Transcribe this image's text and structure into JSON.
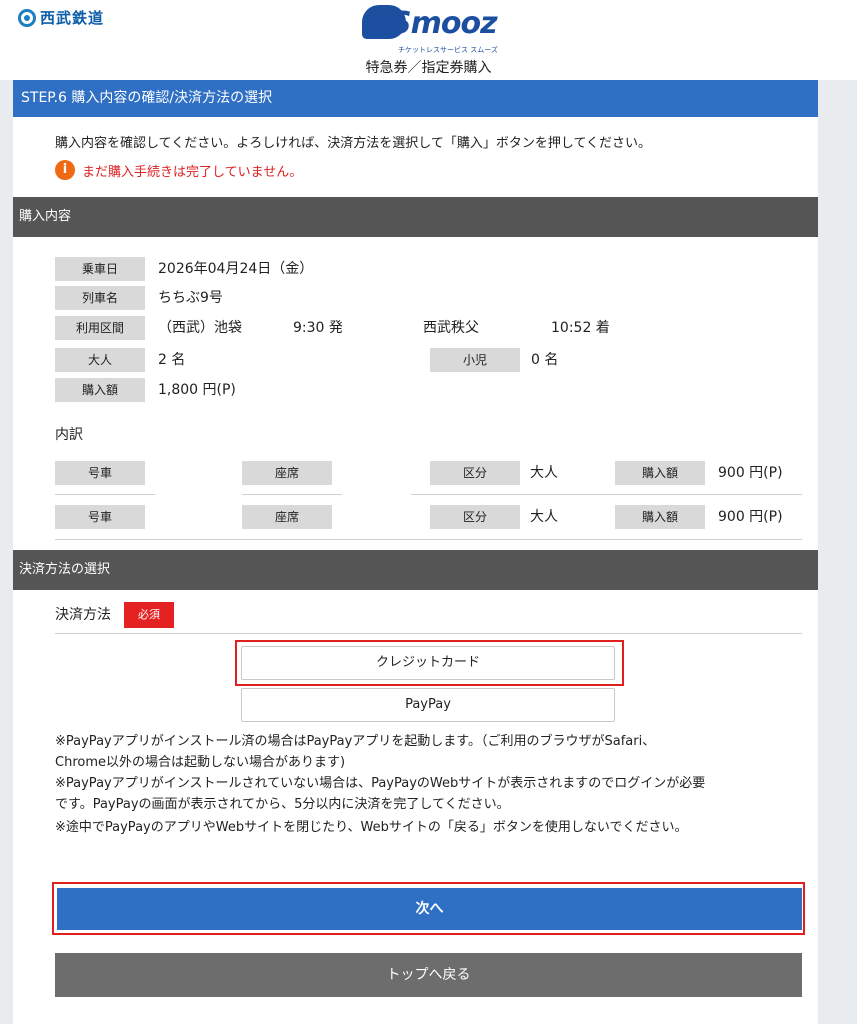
{
  "header": {
    "company_name": "西武鉄道",
    "service_logo": "Smooz",
    "service_tagline": "チケットレスサービス スムーズ",
    "page_subtitle": "特急券／指定券購入"
  },
  "step": {
    "title": "STEP.6 購入内容の確認/決済方法の選択",
    "instruction": "購入内容を確認してください。よろしければ、決済方法を選択して「購入」ボタンを押してください。",
    "warning_icon": "i",
    "warning": "まだ購入手続きは完了していません。"
  },
  "purchase": {
    "section_title": "購入内容",
    "date_label": "乗車日",
    "date_value": "2026年04月24日（金）",
    "train_label": "列車名",
    "train_value": "ちちぶ9号",
    "route_label": "利用区間",
    "route_from": "（西武）池袋",
    "depart_time": "9:30 発",
    "route_to": "西武秩父",
    "arrive_time": "10:52 着",
    "adult_label": "大人",
    "adult_value": "2 名",
    "child_label": "小児",
    "child_value": "0 名",
    "amount_label": "購入額",
    "amount_value": "1,800 円(P)",
    "breakdown_label": "内訳",
    "breakdown": [
      {
        "car_label": "号車",
        "seat_label": "座席",
        "type_label": "区分",
        "type_value": "大人",
        "price_label": "購入額",
        "price_value": "900 円(P)"
      },
      {
        "car_label": "号車",
        "seat_label": "座席",
        "type_label": "区分",
        "type_value": "大人",
        "price_label": "購入額",
        "price_value": "900 円(P)"
      }
    ]
  },
  "payment": {
    "section_title": "決済方法の選択",
    "method_label": "決済方法",
    "required_badge": "必須",
    "option_credit": "クレジットカード",
    "option_paypay": "PayPay",
    "notes": [
      "※PayPayアプリがインストール済の場合はPayPayアプリを起動します。（ご利用のブラウザがSafari、",
      "Chrome以外の場合は起動しない場合があります)",
      "※PayPayアプリがインストールされていない場合は、PayPayのWebサイトが表示されますのでログインが必要",
      "です。PayPayの画面が表示されてから、5分以内に決済を完了してください。",
      "※途中でPayPayのアプリやWebサイトを閉じたり、Webサイトの「戻る」ボタンを使用しないでください。"
    ]
  },
  "actions": {
    "next_label": "次へ",
    "top_label": "トップへ戻る"
  },
  "colors": {
    "primary_blue": "#2f6fc4",
    "section_gray": "#555555",
    "required_red": "#e52222",
    "warning_orange": "#ef6a13",
    "highlight_red": "#e0201f"
  }
}
